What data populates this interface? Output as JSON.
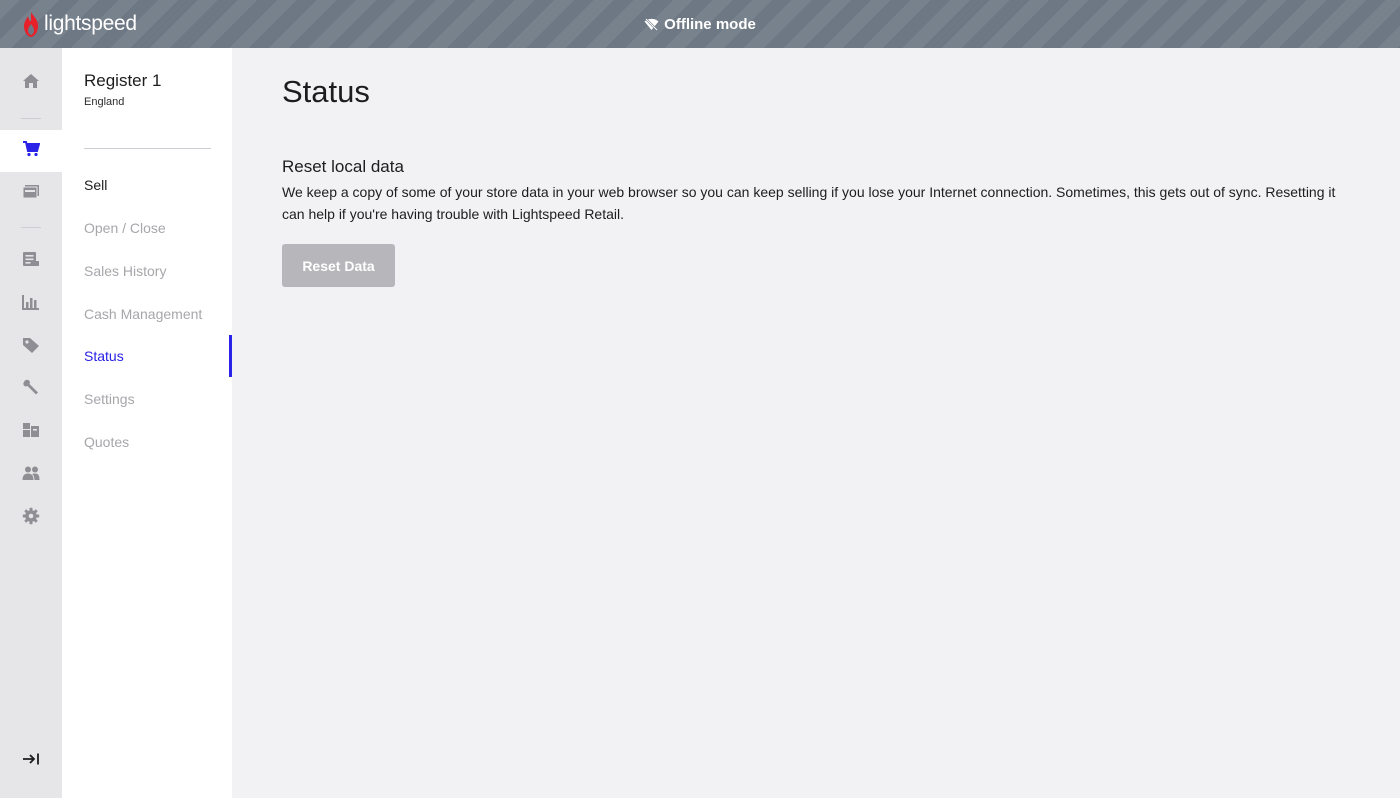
{
  "header": {
    "logo_text": "lightspeed",
    "status_text": "Offline mode"
  },
  "rail": {
    "icons": [
      "home-icon",
      "cart-icon",
      "register-icon",
      "receipt-icon",
      "reports-icon",
      "tag-icon",
      "wrench-icon",
      "inventory-icon",
      "customers-icon",
      "gear-icon",
      "collapse-icon"
    ],
    "active": "cart-icon",
    "accent": "#2a22e6"
  },
  "sidebar": {
    "register_name": "Register 1",
    "register_location": "England",
    "items": [
      {
        "label": "Sell"
      },
      {
        "label": "Open / Close"
      },
      {
        "label": "Sales History"
      },
      {
        "label": "Cash Management"
      },
      {
        "label": "Status"
      },
      {
        "label": "Settings"
      },
      {
        "label": "Quotes"
      }
    ],
    "active_item": "Status"
  },
  "main": {
    "title": "Status",
    "section_title": "Reset local data",
    "section_description": "We keep a copy of some of your store data in your web browser so you can keep selling if you lose your Internet connection. Sometimes, this gets out of sync. Resetting it can help if you're having trouble with Lightspeed Retail.",
    "reset_button_label": "Reset Data"
  }
}
